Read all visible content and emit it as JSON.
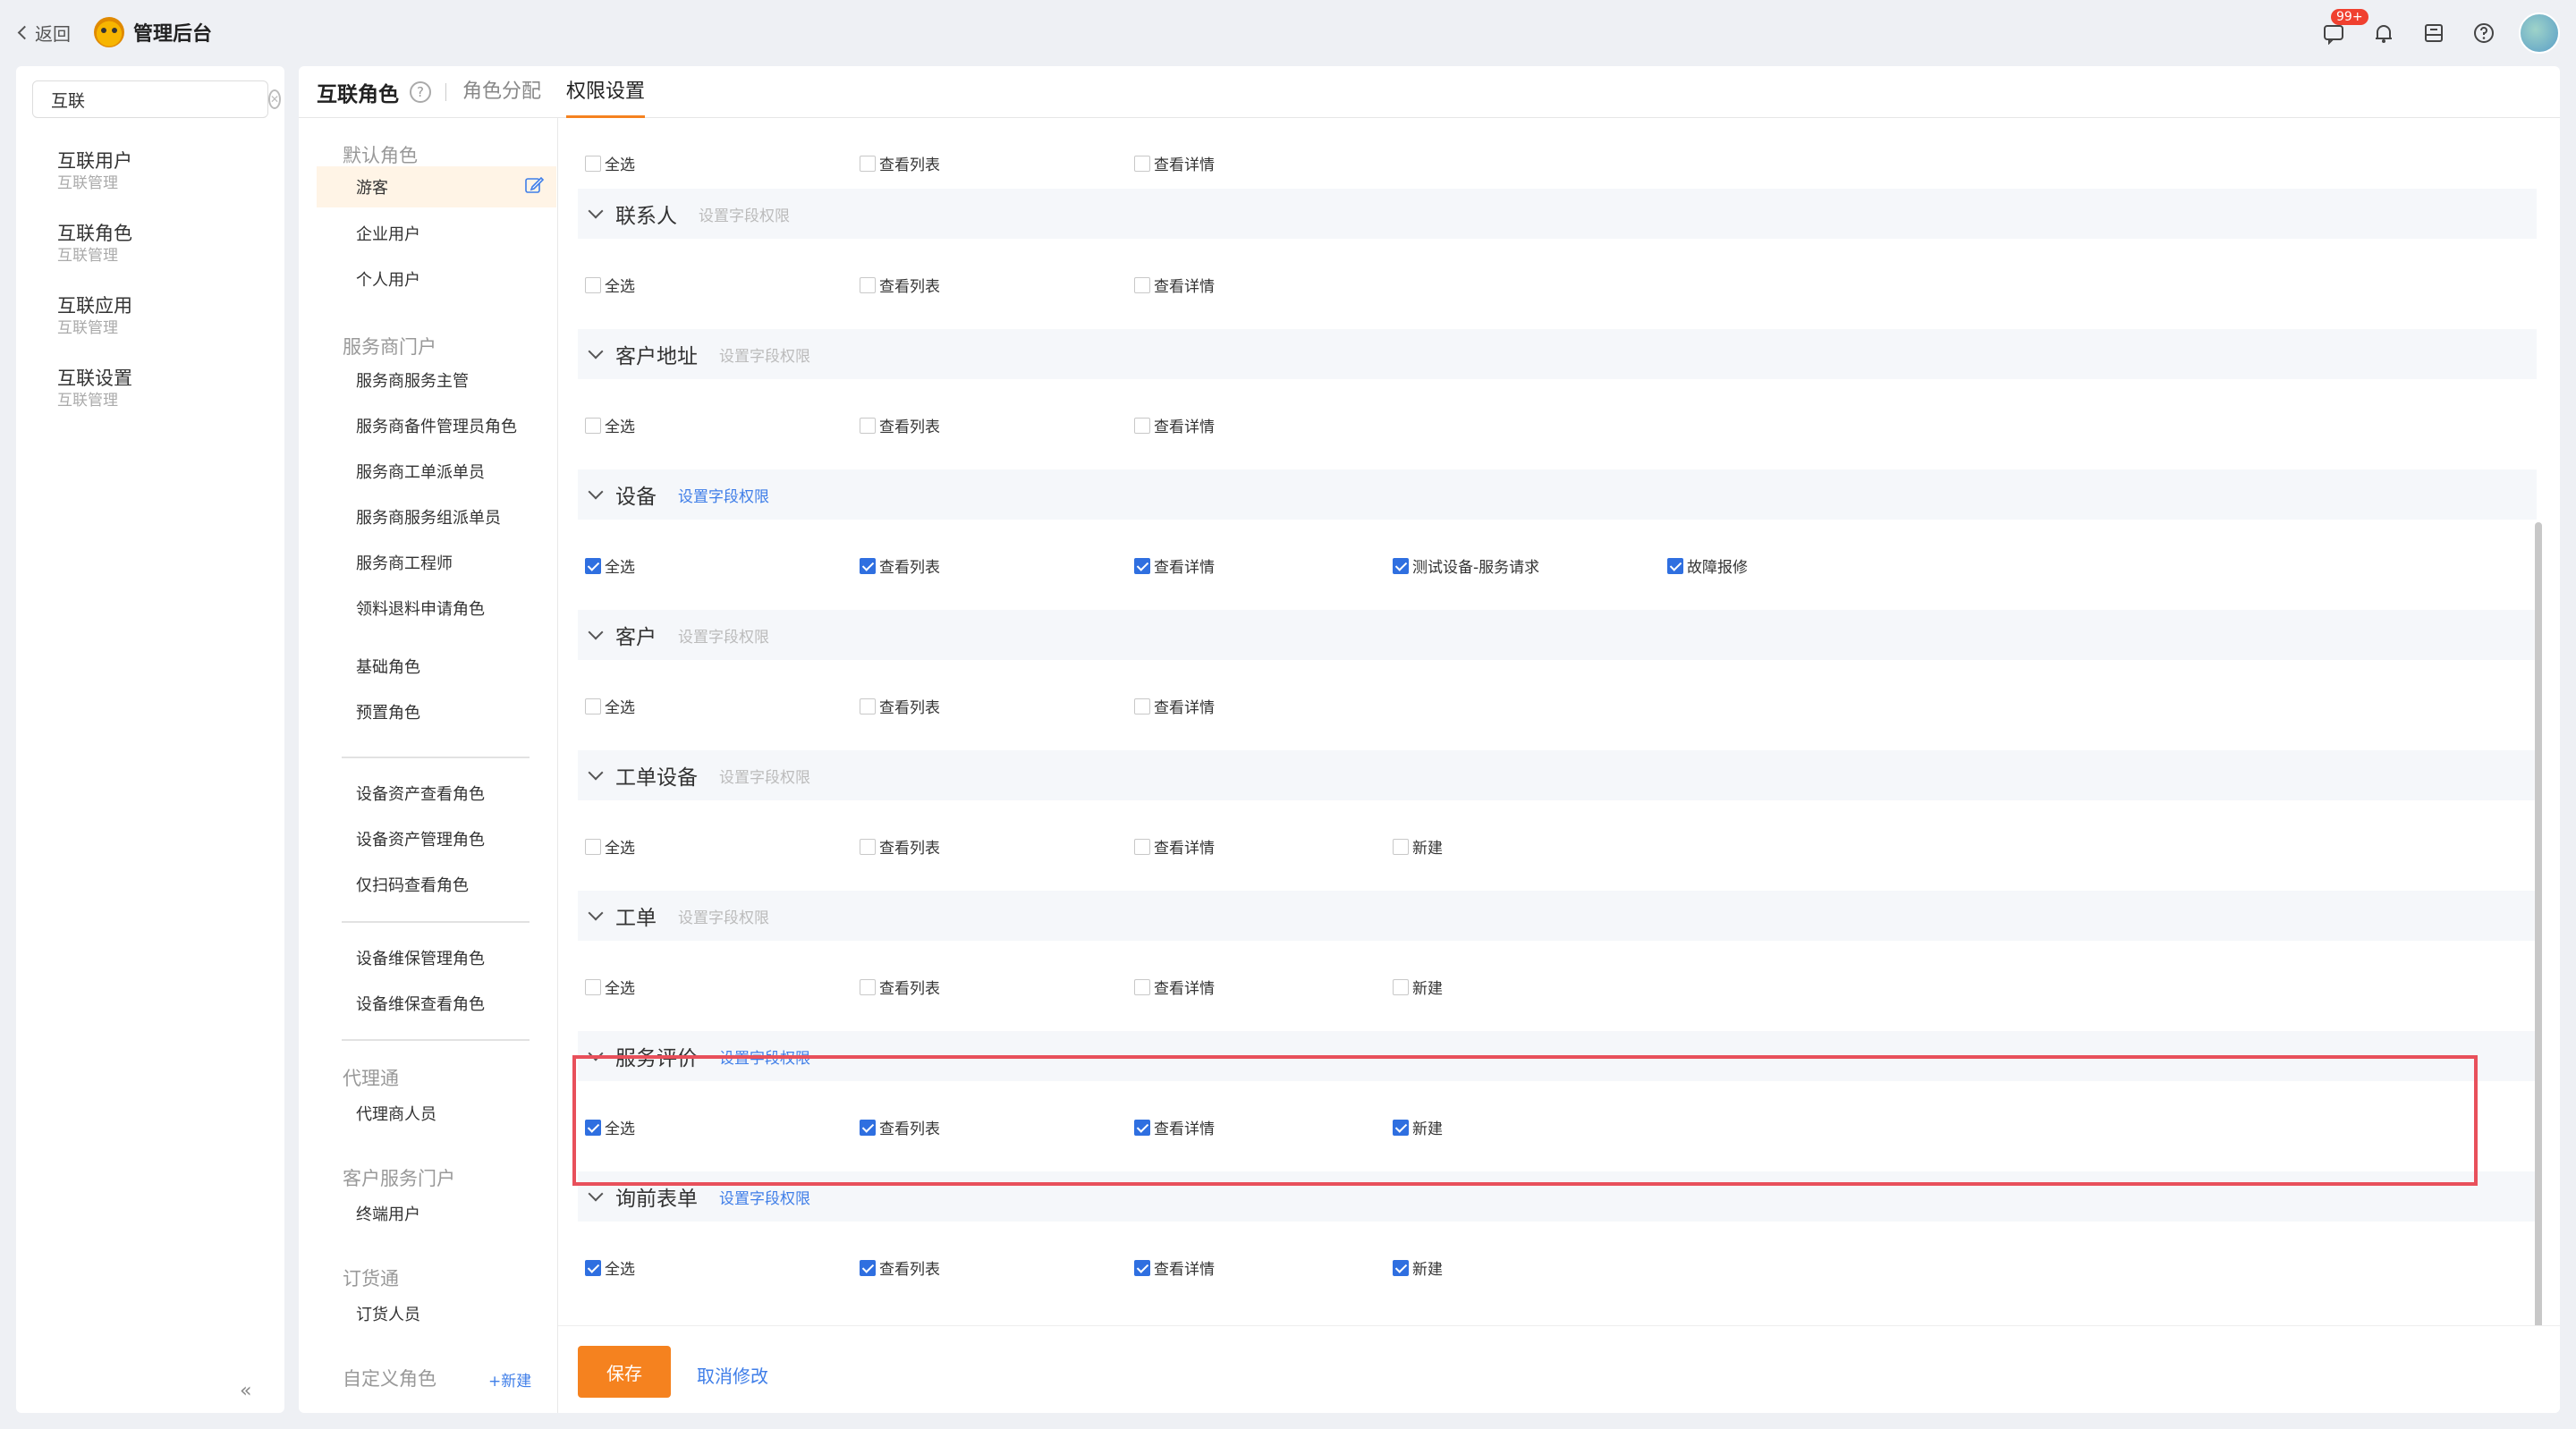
{
  "topbar": {
    "back_label": "返回",
    "app_title": "管理后台",
    "badge_count": "99+"
  },
  "sidebar": {
    "search_value": "互联",
    "items": [
      {
        "title": "互联用户",
        "sub": "互联管理"
      },
      {
        "title": "互联角色",
        "sub": "互联管理"
      },
      {
        "title": "互联应用",
        "sub": "互联管理"
      },
      {
        "title": "互联设置",
        "sub": "互联管理"
      }
    ],
    "collapse_glyph": "«"
  },
  "header": {
    "title": "互联角色",
    "help_glyph": "?",
    "tabs": [
      "角色分配",
      "权限设置"
    ]
  },
  "roles": {
    "group_default": "默认角色",
    "default_roles": [
      "游客",
      "企业用户",
      "个人用户"
    ],
    "group_service": "服务商门户",
    "service_roles": [
      "服务商服务主管",
      "服务商备件管理员角色",
      "服务商工单派单员",
      "服务商服务组派单员",
      "服务商工程师",
      "领料退料申请角色"
    ],
    "misc_roles": [
      "基础角色",
      "预置角色"
    ],
    "asset_roles": [
      "设备资产查看角色",
      "设备资产管理角色",
      "仅扫码查看角色"
    ],
    "maint_roles": [
      "设备维保管理角色",
      "设备维保查看角色"
    ],
    "group_agent": "代理通",
    "agent_roles": [
      "代理商人员"
    ],
    "group_customer": "客户服务门户",
    "customer_roles": [
      "终端用户"
    ],
    "group_order": "订货通",
    "order_roles": [
      "订货人员"
    ],
    "group_custom": "自定义角色",
    "new_label": "+新建"
  },
  "permissions": {
    "field_perm_label": "设置字段权限",
    "top_row": [
      {
        "label": "全选",
        "checked": false
      },
      {
        "label": "查看列表",
        "checked": false
      },
      {
        "label": "查看详情",
        "checked": false
      }
    ],
    "sections": [
      {
        "title": "联系人",
        "link_active": false,
        "options": [
          {
            "label": "全选",
            "checked": false
          },
          {
            "label": "查看列表",
            "checked": false
          },
          {
            "label": "查看详情",
            "checked": false
          }
        ]
      },
      {
        "title": "客户地址",
        "link_active": false,
        "options": [
          {
            "label": "全选",
            "checked": false
          },
          {
            "label": "查看列表",
            "checked": false
          },
          {
            "label": "查看详情",
            "checked": false
          }
        ]
      },
      {
        "title": "设备",
        "link_active": true,
        "options": [
          {
            "label": "全选",
            "checked": true
          },
          {
            "label": "查看列表",
            "checked": true
          },
          {
            "label": "查看详情",
            "checked": true
          },
          {
            "label": "测试设备-服务请求",
            "checked": true
          },
          {
            "label": "故障报修",
            "checked": true
          }
        ]
      },
      {
        "title": "客户",
        "link_active": false,
        "options": [
          {
            "label": "全选",
            "checked": false
          },
          {
            "label": "查看列表",
            "checked": false
          },
          {
            "label": "查看详情",
            "checked": false
          }
        ]
      },
      {
        "title": "工单设备",
        "link_active": false,
        "options": [
          {
            "label": "全选",
            "checked": false
          },
          {
            "label": "查看列表",
            "checked": false
          },
          {
            "label": "查看详情",
            "checked": false
          },
          {
            "label": "新建",
            "checked": false
          }
        ]
      },
      {
        "title": "工单",
        "link_active": false,
        "options": [
          {
            "label": "全选",
            "checked": false
          },
          {
            "label": "查看列表",
            "checked": false
          },
          {
            "label": "查看详情",
            "checked": false
          },
          {
            "label": "新建",
            "checked": false
          }
        ]
      },
      {
        "title": "服务评价",
        "link_active": true,
        "options": [
          {
            "label": "全选",
            "checked": true
          },
          {
            "label": "查看列表",
            "checked": true
          },
          {
            "label": "查看详情",
            "checked": true
          },
          {
            "label": "新建",
            "checked": true
          }
        ]
      },
      {
        "title": "询前表单",
        "link_active": true,
        "options": [
          {
            "label": "全选",
            "checked": true
          },
          {
            "label": "查看列表",
            "checked": true
          },
          {
            "label": "查看详情",
            "checked": true
          },
          {
            "label": "新建",
            "checked": true
          }
        ]
      }
    ]
  },
  "footer": {
    "save_label": "保存",
    "cancel_label": "取消修改"
  },
  "colors": {
    "accent": "#f5821f",
    "link": "#3f7ee8",
    "checkbox": "#2f6fe0",
    "highlight": "#e8505b"
  }
}
